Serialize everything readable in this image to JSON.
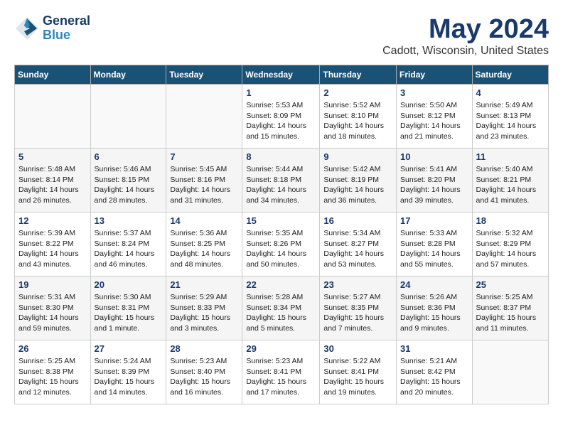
{
  "header": {
    "logo_line1": "General",
    "logo_line2": "Blue",
    "month": "May 2024",
    "location": "Cadott, Wisconsin, United States"
  },
  "weekdays": [
    "Sunday",
    "Monday",
    "Tuesday",
    "Wednesday",
    "Thursday",
    "Friday",
    "Saturday"
  ],
  "weeks": [
    [
      {
        "day": "",
        "info": ""
      },
      {
        "day": "",
        "info": ""
      },
      {
        "day": "",
        "info": ""
      },
      {
        "day": "1",
        "info": "Sunrise: 5:53 AM\nSunset: 8:09 PM\nDaylight: 14 hours and 15 minutes."
      },
      {
        "day": "2",
        "info": "Sunrise: 5:52 AM\nSunset: 8:10 PM\nDaylight: 14 hours and 18 minutes."
      },
      {
        "day": "3",
        "info": "Sunrise: 5:50 AM\nSunset: 8:12 PM\nDaylight: 14 hours and 21 minutes."
      },
      {
        "day": "4",
        "info": "Sunrise: 5:49 AM\nSunset: 8:13 PM\nDaylight: 14 hours and 23 minutes."
      }
    ],
    [
      {
        "day": "5",
        "info": "Sunrise: 5:48 AM\nSunset: 8:14 PM\nDaylight: 14 hours and 26 minutes."
      },
      {
        "day": "6",
        "info": "Sunrise: 5:46 AM\nSunset: 8:15 PM\nDaylight: 14 hours and 28 minutes."
      },
      {
        "day": "7",
        "info": "Sunrise: 5:45 AM\nSunset: 8:16 PM\nDaylight: 14 hours and 31 minutes."
      },
      {
        "day": "8",
        "info": "Sunrise: 5:44 AM\nSunset: 8:18 PM\nDaylight: 14 hours and 34 minutes."
      },
      {
        "day": "9",
        "info": "Sunrise: 5:42 AM\nSunset: 8:19 PM\nDaylight: 14 hours and 36 minutes."
      },
      {
        "day": "10",
        "info": "Sunrise: 5:41 AM\nSunset: 8:20 PM\nDaylight: 14 hours and 39 minutes."
      },
      {
        "day": "11",
        "info": "Sunrise: 5:40 AM\nSunset: 8:21 PM\nDaylight: 14 hours and 41 minutes."
      }
    ],
    [
      {
        "day": "12",
        "info": "Sunrise: 5:39 AM\nSunset: 8:22 PM\nDaylight: 14 hours and 43 minutes."
      },
      {
        "day": "13",
        "info": "Sunrise: 5:37 AM\nSunset: 8:24 PM\nDaylight: 14 hours and 46 minutes."
      },
      {
        "day": "14",
        "info": "Sunrise: 5:36 AM\nSunset: 8:25 PM\nDaylight: 14 hours and 48 minutes."
      },
      {
        "day": "15",
        "info": "Sunrise: 5:35 AM\nSunset: 8:26 PM\nDaylight: 14 hours and 50 minutes."
      },
      {
        "day": "16",
        "info": "Sunrise: 5:34 AM\nSunset: 8:27 PM\nDaylight: 14 hours and 53 minutes."
      },
      {
        "day": "17",
        "info": "Sunrise: 5:33 AM\nSunset: 8:28 PM\nDaylight: 14 hours and 55 minutes."
      },
      {
        "day": "18",
        "info": "Sunrise: 5:32 AM\nSunset: 8:29 PM\nDaylight: 14 hours and 57 minutes."
      }
    ],
    [
      {
        "day": "19",
        "info": "Sunrise: 5:31 AM\nSunset: 8:30 PM\nDaylight: 14 hours and 59 minutes."
      },
      {
        "day": "20",
        "info": "Sunrise: 5:30 AM\nSunset: 8:31 PM\nDaylight: 15 hours and 1 minute."
      },
      {
        "day": "21",
        "info": "Sunrise: 5:29 AM\nSunset: 8:33 PM\nDaylight: 15 hours and 3 minutes."
      },
      {
        "day": "22",
        "info": "Sunrise: 5:28 AM\nSunset: 8:34 PM\nDaylight: 15 hours and 5 minutes."
      },
      {
        "day": "23",
        "info": "Sunrise: 5:27 AM\nSunset: 8:35 PM\nDaylight: 15 hours and 7 minutes."
      },
      {
        "day": "24",
        "info": "Sunrise: 5:26 AM\nSunset: 8:36 PM\nDaylight: 15 hours and 9 minutes."
      },
      {
        "day": "25",
        "info": "Sunrise: 5:25 AM\nSunset: 8:37 PM\nDaylight: 15 hours and 11 minutes."
      }
    ],
    [
      {
        "day": "26",
        "info": "Sunrise: 5:25 AM\nSunset: 8:38 PM\nDaylight: 15 hours and 12 minutes."
      },
      {
        "day": "27",
        "info": "Sunrise: 5:24 AM\nSunset: 8:39 PM\nDaylight: 15 hours and 14 minutes."
      },
      {
        "day": "28",
        "info": "Sunrise: 5:23 AM\nSunset: 8:40 PM\nDaylight: 15 hours and 16 minutes."
      },
      {
        "day": "29",
        "info": "Sunrise: 5:23 AM\nSunset: 8:41 PM\nDaylight: 15 hours and 17 minutes."
      },
      {
        "day": "30",
        "info": "Sunrise: 5:22 AM\nSunset: 8:41 PM\nDaylight: 15 hours and 19 minutes."
      },
      {
        "day": "31",
        "info": "Sunrise: 5:21 AM\nSunset: 8:42 PM\nDaylight: 15 hours and 20 minutes."
      },
      {
        "day": "",
        "info": ""
      }
    ]
  ]
}
